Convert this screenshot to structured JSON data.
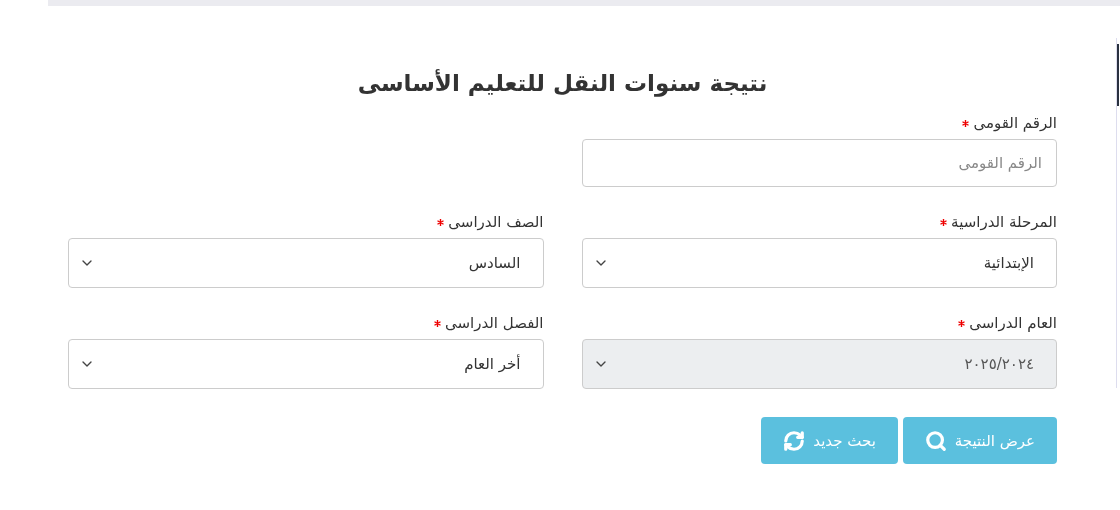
{
  "title": "نتيجة سنوات النقل للتعليم الأساسى",
  "rows": [
    [
      {
        "kind": "input",
        "label": "الرقم القومى",
        "required": true,
        "placeholder": "الرقم القومى"
      }
    ],
    [
      {
        "kind": "select",
        "label": "المرحلة الدراسية",
        "required": true,
        "value": "الإبتدائية",
        "disabled": false
      },
      {
        "kind": "select",
        "label": "الصف الدراسى",
        "required": true,
        "value": "السادس",
        "disabled": false
      }
    ],
    [
      {
        "kind": "select",
        "label": "العام الدراسى",
        "required": true,
        "value": "٢٠٢٥/٢٠٢٤",
        "disabled": true
      },
      {
        "kind": "select",
        "label": "الفصل الدراسى",
        "required": true,
        "value": "أخر العام",
        "disabled": false
      }
    ]
  ],
  "buttons": [
    {
      "kind": "search",
      "label": "عرض النتيجة"
    },
    {
      "kind": "refresh",
      "label": "بحث جديد"
    }
  ]
}
